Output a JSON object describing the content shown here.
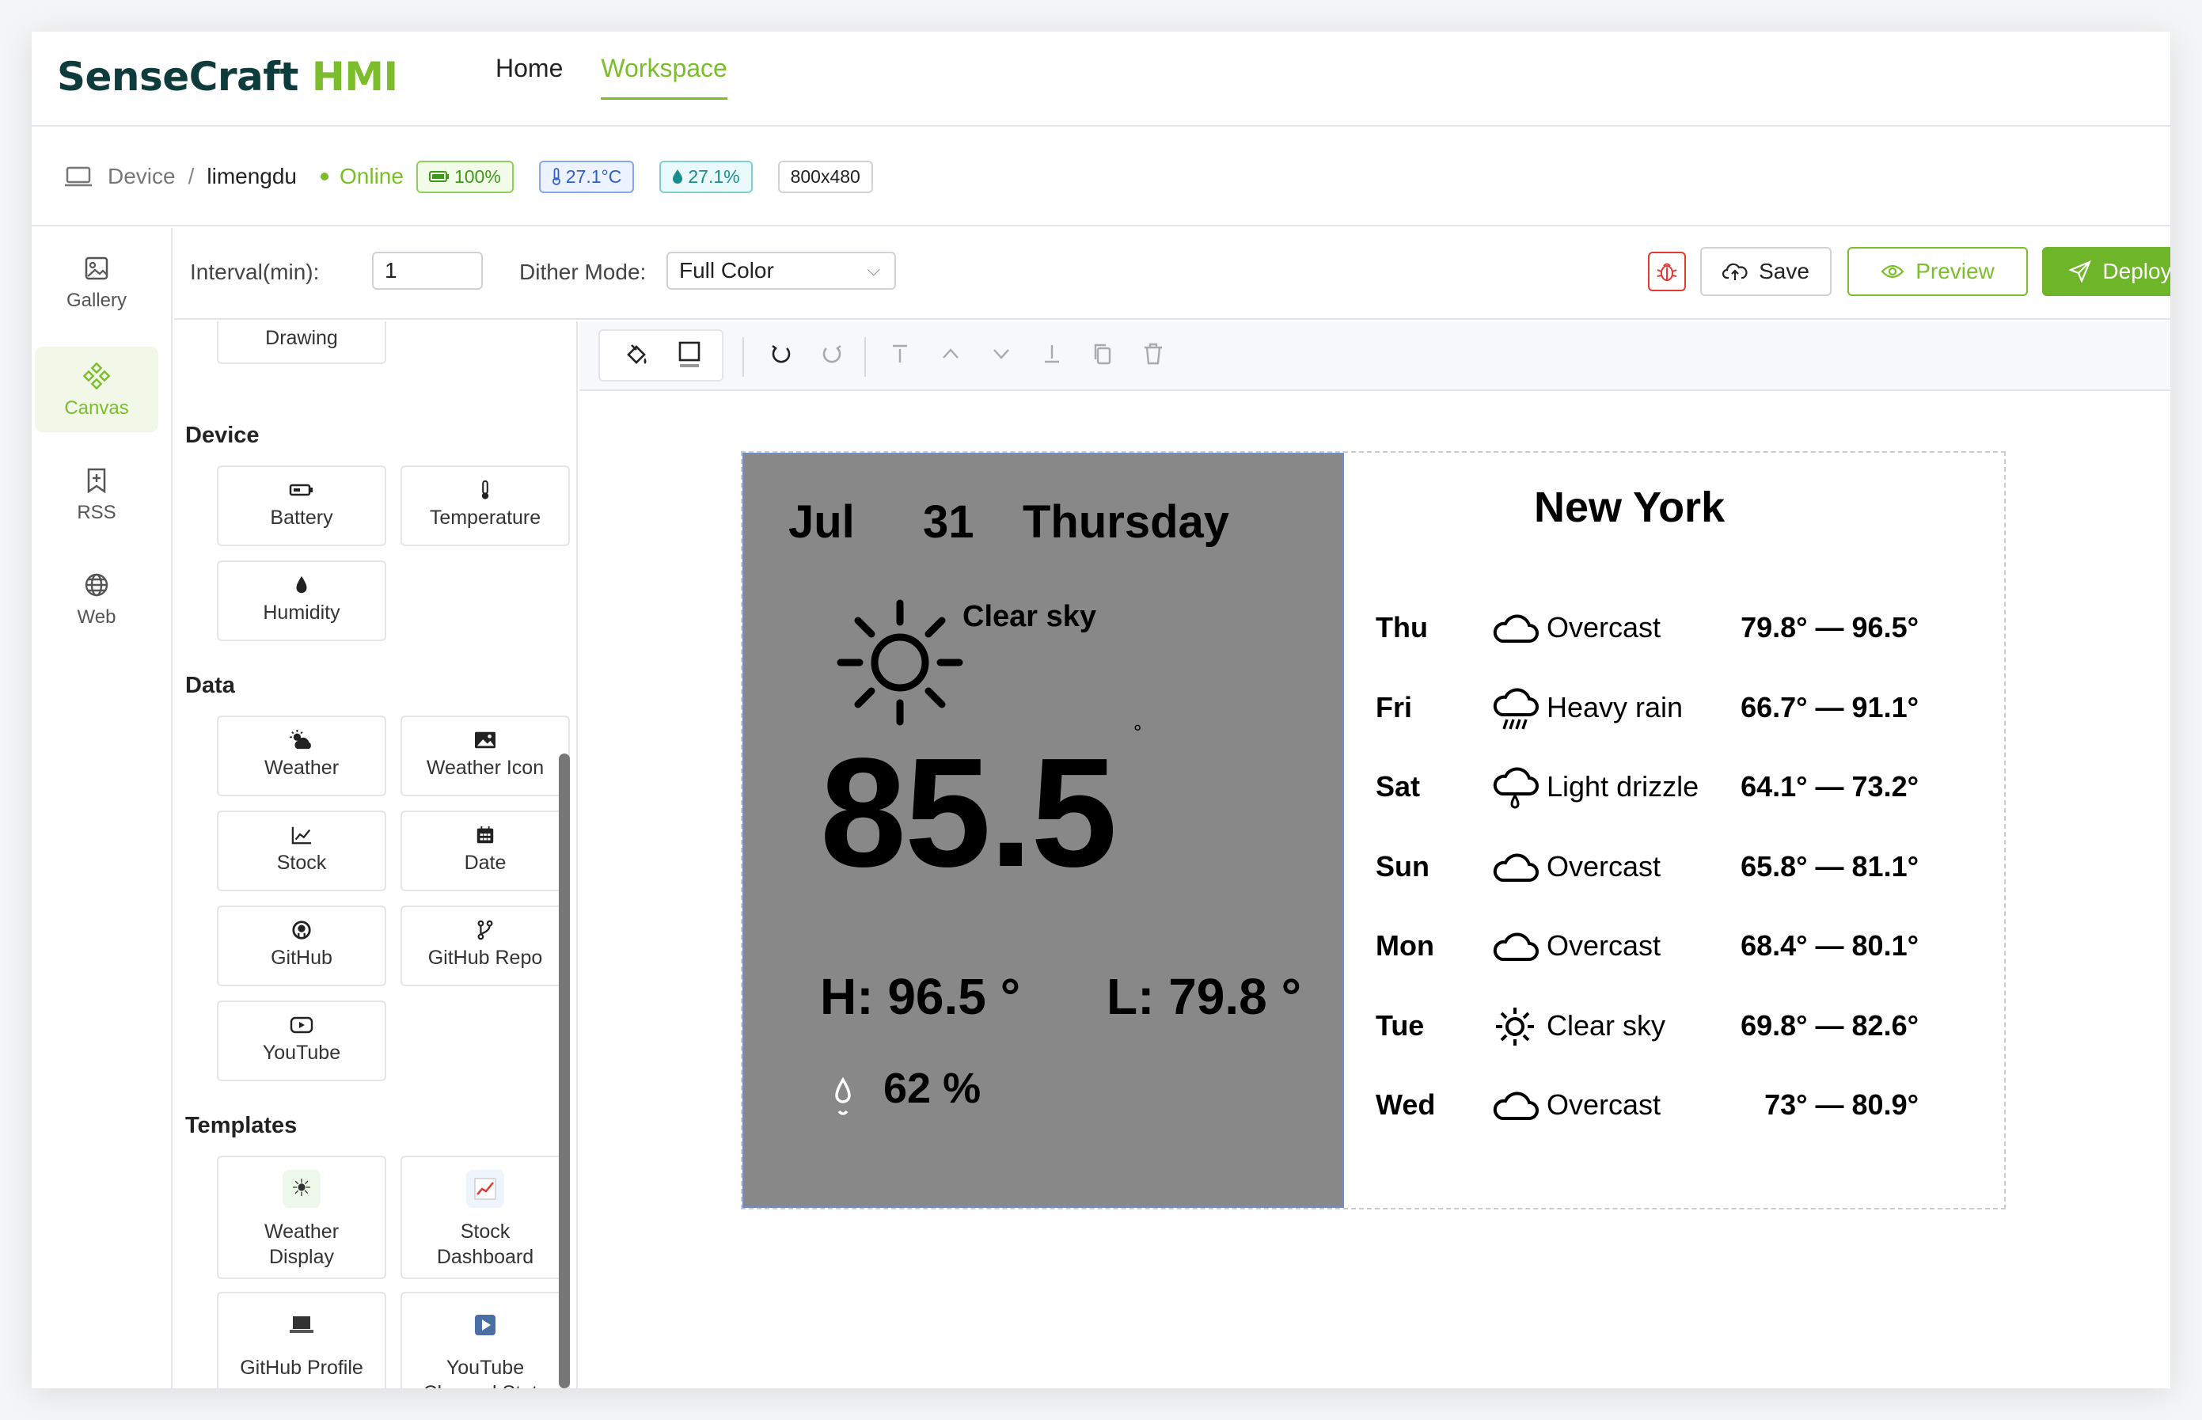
{
  "app": {
    "brand_main": "SenseCraft",
    "brand_accent": "HMI"
  },
  "nav": {
    "home": "Home",
    "workspace": "Workspace"
  },
  "device": {
    "crumb_root": "Device",
    "crumb_sep": "/",
    "name": "limengdu",
    "status": "Online",
    "battery": "100%",
    "temperature": "27.1°C",
    "humidity": "27.1%",
    "resolution": "800x480"
  },
  "rail": {
    "gallery": "Gallery",
    "canvas": "Canvas",
    "rss": "RSS",
    "web": "Web"
  },
  "options": {
    "interval_label": "Interval(min):",
    "interval_value": "1",
    "dither_label": "Dither Mode:",
    "dither_value": "Full Color",
    "save": "Save",
    "preview": "Preview",
    "deploy": "Deploy"
  },
  "panel": {
    "drawing": "Drawing",
    "device_title": "Device",
    "battery": "Battery",
    "temperature": "Temperature",
    "humidity": "Humidity",
    "data_title": "Data",
    "weather": "Weather",
    "weather_icon": "Weather Icon",
    "stock": "Stock",
    "date": "Date",
    "github": "GitHub",
    "github_repo": "GitHub Repo",
    "youtube": "YouTube",
    "templates_title": "Templates",
    "tpl_weather_1": "Weather",
    "tpl_weather_2": "Display",
    "tpl_stock_1": "Stock",
    "tpl_stock_2": "Dashboard",
    "tpl_github": "GitHub Profile",
    "tpl_youtube_1": "YouTube",
    "tpl_youtube_2": "Channel Stats"
  },
  "weather": {
    "month": "Jul",
    "day": "31",
    "weekday": "Thursday",
    "condition": "Clear sky",
    "temp": "85.5",
    "deg": "°",
    "high": "H:  96.5 °",
    "low": "L:  79.8 °",
    "humidity": "62 %",
    "city": "New York",
    "forecast": [
      {
        "day": "Thu",
        "icon": "cloud-icon",
        "cond": "Overcast",
        "range": "79.8°  —  96.5°"
      },
      {
        "day": "Fri",
        "icon": "rain-icon",
        "cond": "Heavy rain",
        "range": "66.7°  —  91.1°"
      },
      {
        "day": "Sat",
        "icon": "drizzle-icon",
        "cond": "Light drizzle",
        "range": "64.1°  —  73.2°"
      },
      {
        "day": "Sun",
        "icon": "cloud-icon",
        "cond": "Overcast",
        "range": "65.8°  —  81.1°"
      },
      {
        "day": "Mon",
        "icon": "cloud-icon",
        "cond": "Overcast",
        "range": "68.4°  —  80.1°"
      },
      {
        "day": "Tue",
        "icon": "sun-icon",
        "cond": "Clear sky",
        "range": "69.8°  —  82.6°"
      },
      {
        "day": "Wed",
        "icon": "cloud-icon",
        "cond": "Overcast",
        "range": "73°  —  80.9°"
      }
    ]
  },
  "colors": {
    "accent": "#7bbd2a",
    "danger": "#e53935",
    "display_gray": "#888888"
  }
}
